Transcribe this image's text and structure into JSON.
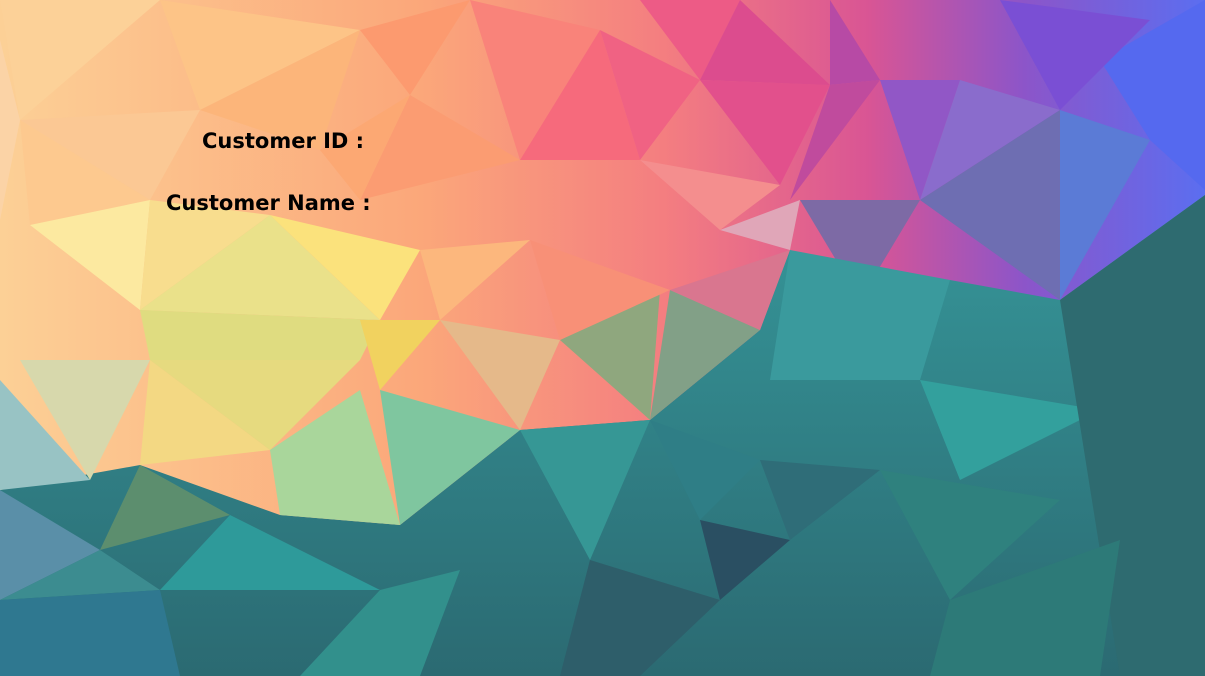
{
  "form": {
    "customer_id_label": "Customer ID :",
    "customer_name_label": "Customer Name :"
  },
  "background": {
    "description_icon": "low-poly-gradient-background",
    "colors": {
      "peach": "#fcc987",
      "coral": "#f98a7e",
      "pink": "#ee5a87",
      "purple": "#9350c6",
      "blue": "#5571ee",
      "yellow": "#f6e27a",
      "teal": "#2f8f8f",
      "dark_teal": "#2c6470"
    }
  }
}
